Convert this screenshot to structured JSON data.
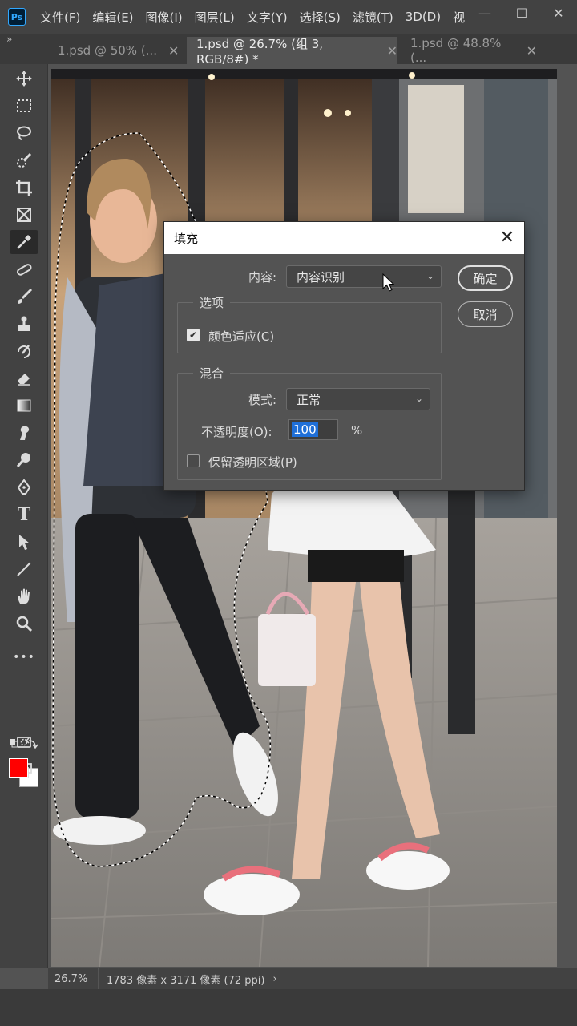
{
  "app": {
    "logo": "Ps",
    "menu": [
      "文件(F)",
      "编辑(E)",
      "图像(I)",
      "图层(L)",
      "文字(Y)",
      "选择(S)",
      "滤镜(T)",
      "3D(D)",
      "视"
    ],
    "window_controls": {
      "minimize": "—",
      "restore": "☐",
      "close": "✕"
    }
  },
  "tabs": [
    {
      "label": "1.psd @ 50% (..."
    },
    {
      "label": "1.psd @ 26.7% (组 3, RGB/8#) *"
    },
    {
      "label": "1.psd @ 48.8% (..."
    }
  ],
  "tabs_panel_toggle": "»",
  "toolbar": {
    "tools": [
      "move-tool",
      "marquee-tool",
      "lasso-tool",
      "quick-selection-tool",
      "crop-tool",
      "frame-tool",
      "eyedropper-tool",
      "healing-tool",
      "brush-tool",
      "clone-stamp-tool",
      "history-brush-tool",
      "eraser-tool",
      "gradient-tool",
      "smudge-tool",
      "dodge-tool",
      "pen-tool",
      "type-tool",
      "path-selection-tool",
      "line-tool",
      "hand-tool",
      "zoom-tool",
      "more-tools",
      "quick-mask",
      "screen-mode"
    ],
    "type_glyph": "T",
    "more_glyph": "•••",
    "foreground_color": "#ff0000",
    "background_color": "#ffffff"
  },
  "status": {
    "zoom": "26.7%",
    "doc_info": "1783 像素 x 3171 像素 (72 ppi)",
    "arrow": "›"
  },
  "dialog": {
    "title": "填充",
    "close": "✕",
    "content_label": "内容:",
    "content_value": "内容识别",
    "options_group": "选项",
    "color_adapt_label": "颜色适应(C)",
    "color_adapt_checked": true,
    "blend_group": "混合",
    "mode_label": "模式:",
    "mode_value": "正常",
    "opacity_label": "不透明度(O):",
    "opacity_value": "100",
    "opacity_unit": "%",
    "preserve_label": "保留透明区域(P)",
    "preserve_checked": false,
    "ok_label": "确定",
    "cancel_label": "取消"
  }
}
